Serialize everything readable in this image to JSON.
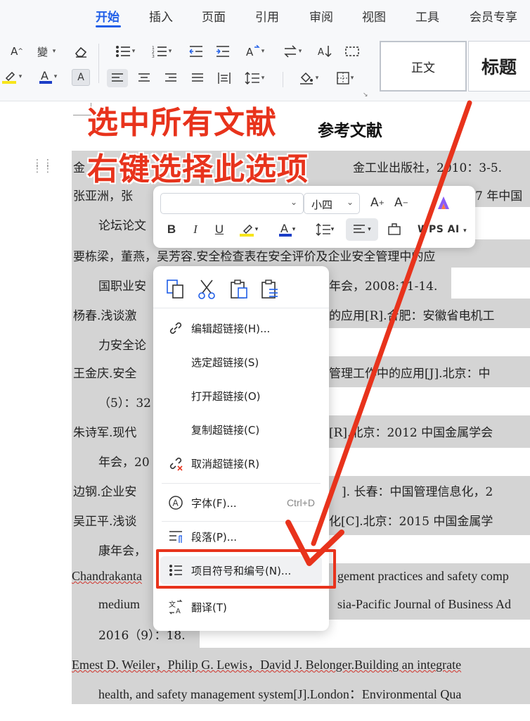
{
  "ribbon": {
    "tabs": [
      "开始",
      "插入",
      "页面",
      "引用",
      "审阅",
      "视图",
      "工具",
      "会员专享"
    ],
    "active_tab": "开始",
    "style_normal": "正文",
    "style_heading": "标题",
    "accent": "#1f5ee8"
  },
  "document": {
    "title": "参考文献",
    "lines": [
      "金",
      "金工业出版社，2010：3-5.",
      "张亚洲，张",
      "7 年中国",
      "论坛论文",
      "要栋梁，董燕，吴芳容.安全检查表在安全评价及企业安全管理中的应",
      "国职业安",
      "年会，2008:11-14.",
      "杨春.浅谈激",
      "的应用[R].合肥：安徽省电机工",
      "力安全论",
      "王金庆.安全",
      "管理工作中的应用[J].北京：中",
      "（5）：32",
      "朱诗军.现代",
      "[R].北京：2012 中国金属学会",
      "年会，20",
      "边钢.企业安",
      "]. 长春：中国管理信息化，2",
      "吴正平.浅谈",
      "化[C].北京：2015 中国金属学",
      "康年会，",
      "Chandrakanta",
      "gement practices and safety comp",
      "medium",
      "sia-Pacific Journal of Business Ad",
      "2016（9）：18.",
      "Emest D. Weiler，Philip G. Lewis，David J. Belonger.Building an integrate",
      "health, and safety management system[J].London：Environmental Qua"
    ]
  },
  "annotation": {
    "line1": "选中所有文献",
    "line2": "右键选择此选项",
    "color": "#e8331c"
  },
  "mini_toolbar": {
    "font_size": "小四",
    "wps_ai": "WPS AI"
  },
  "context_menu": {
    "items": [
      {
        "label": "编辑超链接(H)...",
        "icon": "link-icon"
      },
      {
        "label": "选定超链接(S)",
        "icon": ""
      },
      {
        "label": "打开超链接(O)",
        "icon": ""
      },
      {
        "label": "复制超链接(C)",
        "icon": ""
      },
      {
        "label": "取消超链接(R)",
        "icon": "unlink-icon"
      },
      {
        "label": "字体(F)...",
        "icon": "font-icon",
        "shortcut": "Ctrl+D"
      },
      {
        "label": "段落(P)...",
        "icon": "paragraph-icon"
      },
      {
        "label": "项目符号和编号(N)...",
        "icon": "bullet-list-icon"
      },
      {
        "label": "翻译(T)",
        "icon": "translate-icon"
      }
    ]
  }
}
